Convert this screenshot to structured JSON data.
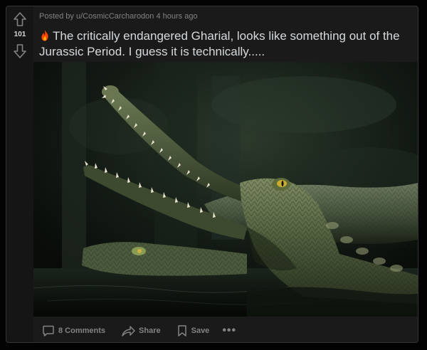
{
  "post": {
    "votes": {
      "score": "101",
      "upvote_icon": "arrow-up-icon",
      "downvote_icon": "arrow-down-icon"
    },
    "meta": "Posted by u/CosmicCarcharodon 4 hours ago",
    "flair_icon": "fire-icon",
    "title": "The critically endangered Gharial, looks like something out of the Jurassic Period. I guess it is technically.....",
    "image": {
      "subject": "gharial photo"
    },
    "actions": {
      "comments_label": "8 Comments",
      "share_label": "Share",
      "save_label": "Save",
      "more_label": "•••"
    }
  },
  "colors": {
    "background": "#030303",
    "card": "#1a1a1b",
    "text": "#d7dadc",
    "muted": "#818384",
    "flame": "#ff4500"
  }
}
